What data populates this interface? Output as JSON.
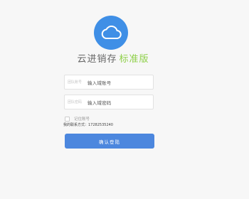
{
  "app": {
    "name": "云进销存",
    "edition": "标准版",
    "logo_icon": "cloud-icon",
    "brand_color": "#3f8fe6",
    "edition_color": "#8fd04a"
  },
  "form": {
    "account": {
      "label": "团队账号",
      "placeholder": "输入域账号"
    },
    "password": {
      "label": "团队密码",
      "placeholder": "输入域密码"
    },
    "remember_label": "记住账号",
    "contact": "我的联系方式：17282535240",
    "submit_label": "确认登陆",
    "submit_color": "#4c87de"
  }
}
